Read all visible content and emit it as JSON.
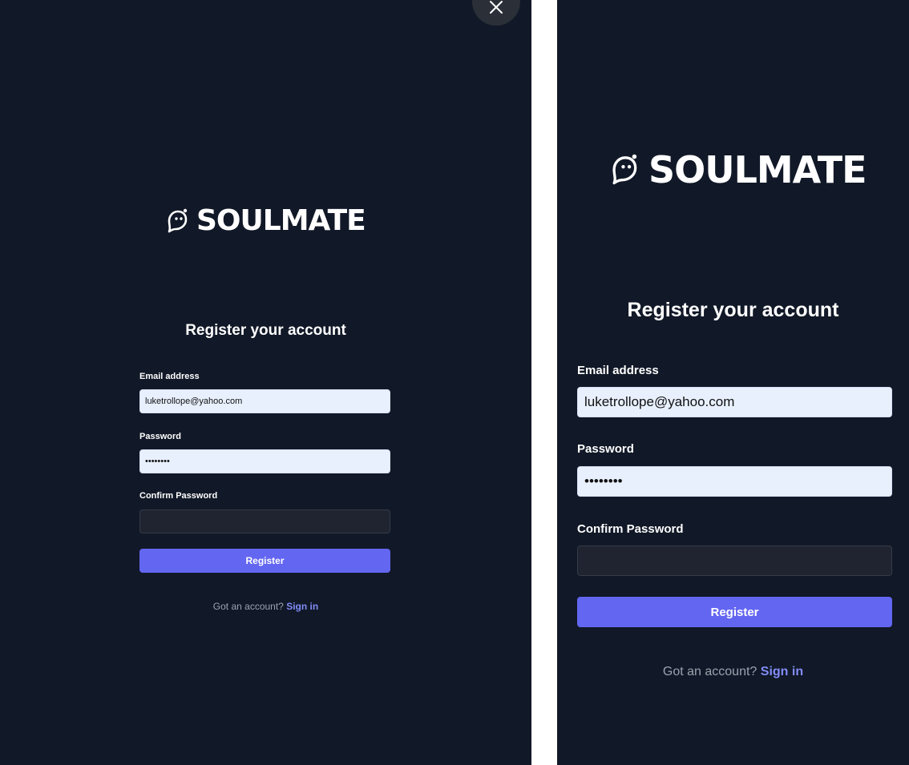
{
  "brand": {
    "name": "SOULMATE",
    "logo_icon": "ghost-chat-bubble-icon"
  },
  "form": {
    "title": "Register your account",
    "email_label": "Email address",
    "email_value": "luketrollope@yahoo.com",
    "password_label": "Password",
    "password_value": "••••••••",
    "confirm_label": "Confirm Password",
    "confirm_value": "",
    "register_label": "Register"
  },
  "footer": {
    "prompt": "Got an account?",
    "signin_label": "Sign in"
  },
  "dialog": {
    "close_icon": "close-icon"
  },
  "colors": {
    "background": "#111827",
    "accent": "#6366f1",
    "link": "#818cf8",
    "input_filled": "#e8f0fe",
    "input_empty": "#1f2430"
  }
}
